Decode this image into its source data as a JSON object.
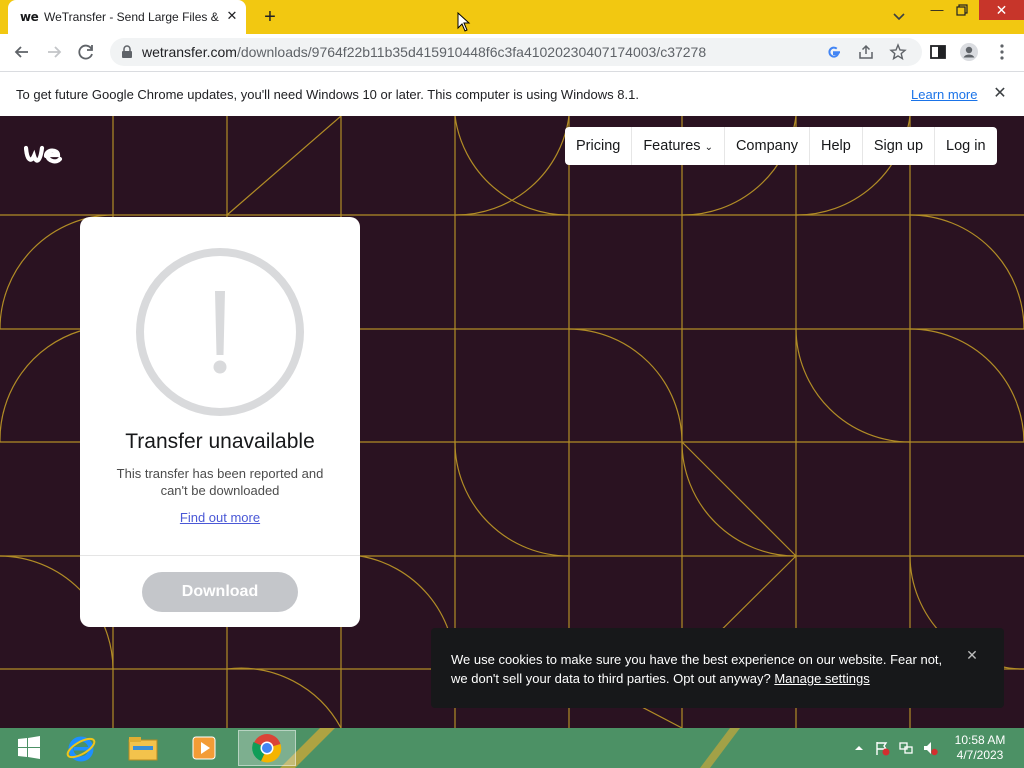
{
  "browser": {
    "tab_favicon": "we",
    "tab_title": "WeTransfer - Send Large Files & Share Photos Online",
    "tab_close": "✕",
    "new_tab": "+",
    "minimize": "—",
    "close": "✕",
    "url_host": "wetransfer.com",
    "url_path": "/downloads/9764f22b11b35d415910448f6c3fa41020230407174003/c37278"
  },
  "infobar": {
    "message": "To get future Google Chrome updates, you'll need Windows 10 or later. This computer is using Windows 8.1.",
    "link": "Learn more",
    "close": "✕"
  },
  "nav": {
    "items": [
      "Pricing",
      "Features",
      "Company",
      "Help",
      "Sign up",
      "Log in"
    ],
    "features_chevron": "⌄"
  },
  "card": {
    "title": "Transfer unavailable",
    "message": "This transfer has been reported and can't be downloaded",
    "link": "Find out more",
    "button": "Download"
  },
  "cookie": {
    "text": "We use cookies to make sure you have the best experience on our website. Fear not, we don't sell your data to third parties. Opt out anyway?",
    "link": "Manage settings",
    "close": "✕"
  },
  "taskbar": {
    "time": "10:58 AM",
    "date": "4/7/2023"
  },
  "colors": {
    "tab_strip": "#f2c811",
    "page_background": "#2a1221",
    "pattern_line": "#c9a227",
    "taskbar": "#4c9165"
  }
}
